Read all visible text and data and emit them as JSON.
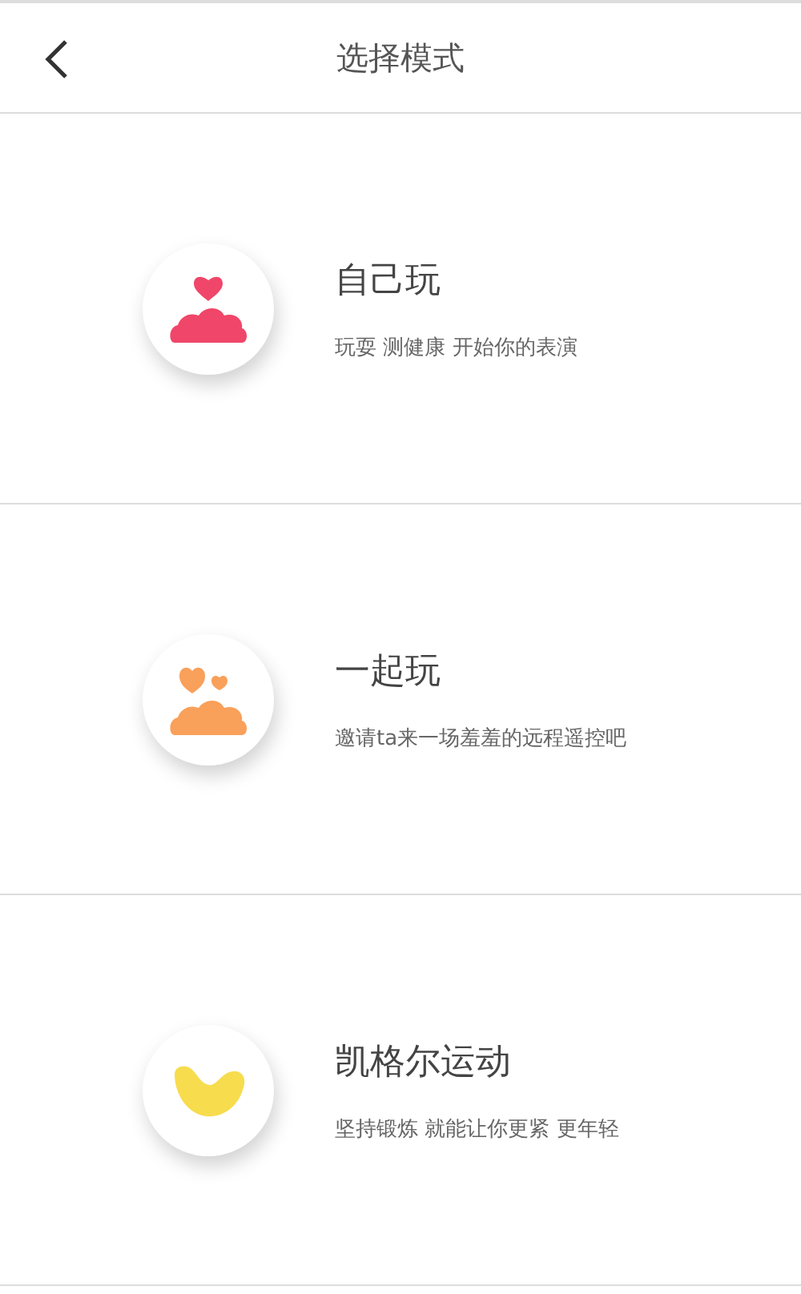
{
  "header": {
    "title": "选择模式"
  },
  "modes": [
    {
      "kind": "solo",
      "color": "#f0466a",
      "title": "自己玩",
      "subtitle": "玩耍 测健康 开始你的表演"
    },
    {
      "kind": "duo",
      "color": "#f9a05a",
      "title": "一起玩",
      "subtitle": "邀请ta来一场羞羞的远程遥控吧"
    },
    {
      "kind": "kegel",
      "color": "#f7dc4e",
      "title": "凯格尔运动",
      "subtitle": "坚持锻炼 就能让你更紧 更年轻"
    }
  ]
}
